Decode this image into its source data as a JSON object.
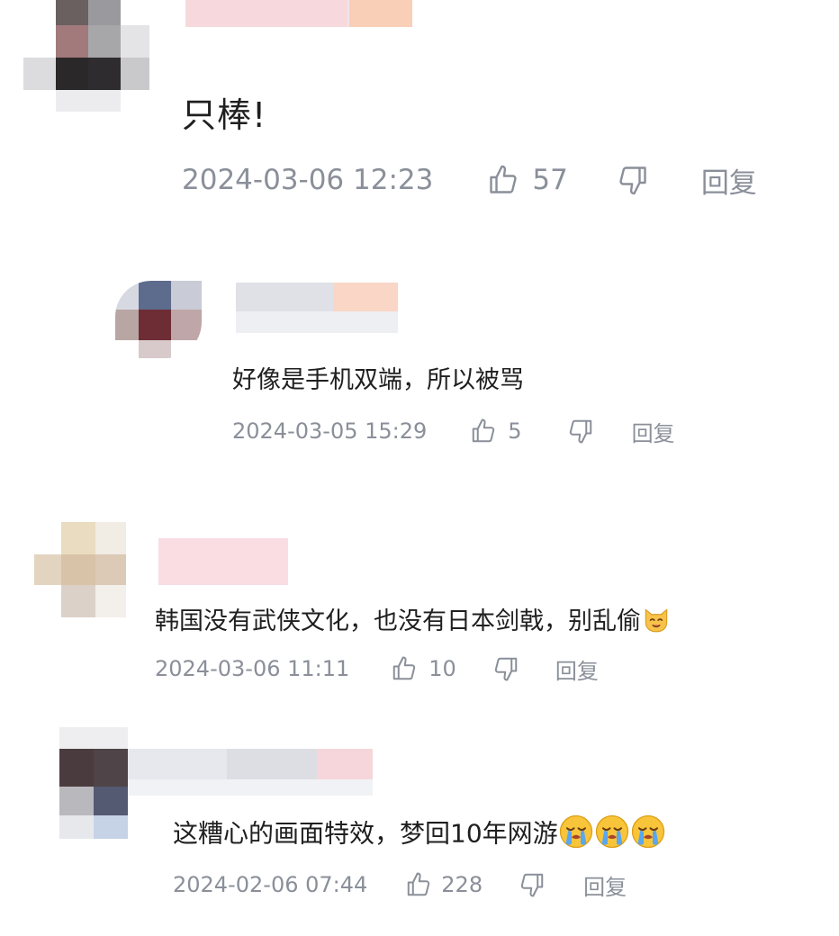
{
  "comments": [
    {
      "text": "只棒!",
      "time": "2024-03-06 12:23",
      "likes": "57",
      "reply_label": "回复",
      "emojis": []
    },
    {
      "text": "好像是手机双端，所以被骂",
      "time": "2024-03-05 15:29",
      "likes": "5",
      "reply_label": "回复",
      "emojis": []
    },
    {
      "text": "韩国没有武侠文化，也没有日本剑戟，别乱偷",
      "time": "2024-03-06 11:11",
      "likes": "10",
      "reply_label": "回复",
      "emojis": [
        "cat-face-emoji"
      ]
    },
    {
      "text": "这糟心的画面特效，梦回10年网游",
      "time": "2024-02-06 07:44",
      "likes": "228",
      "reply_label": "回复",
      "emojis": [
        "crying-face-emoji",
        "crying-face-emoji",
        "crying-face-emoji"
      ]
    }
  ],
  "icons": {
    "like": "thumbs-up-icon",
    "dislike": "thumbs-down-icon"
  },
  "colors": {
    "text": "#1f1f1f",
    "meta": "#8a8f99",
    "background": "#ffffff"
  }
}
